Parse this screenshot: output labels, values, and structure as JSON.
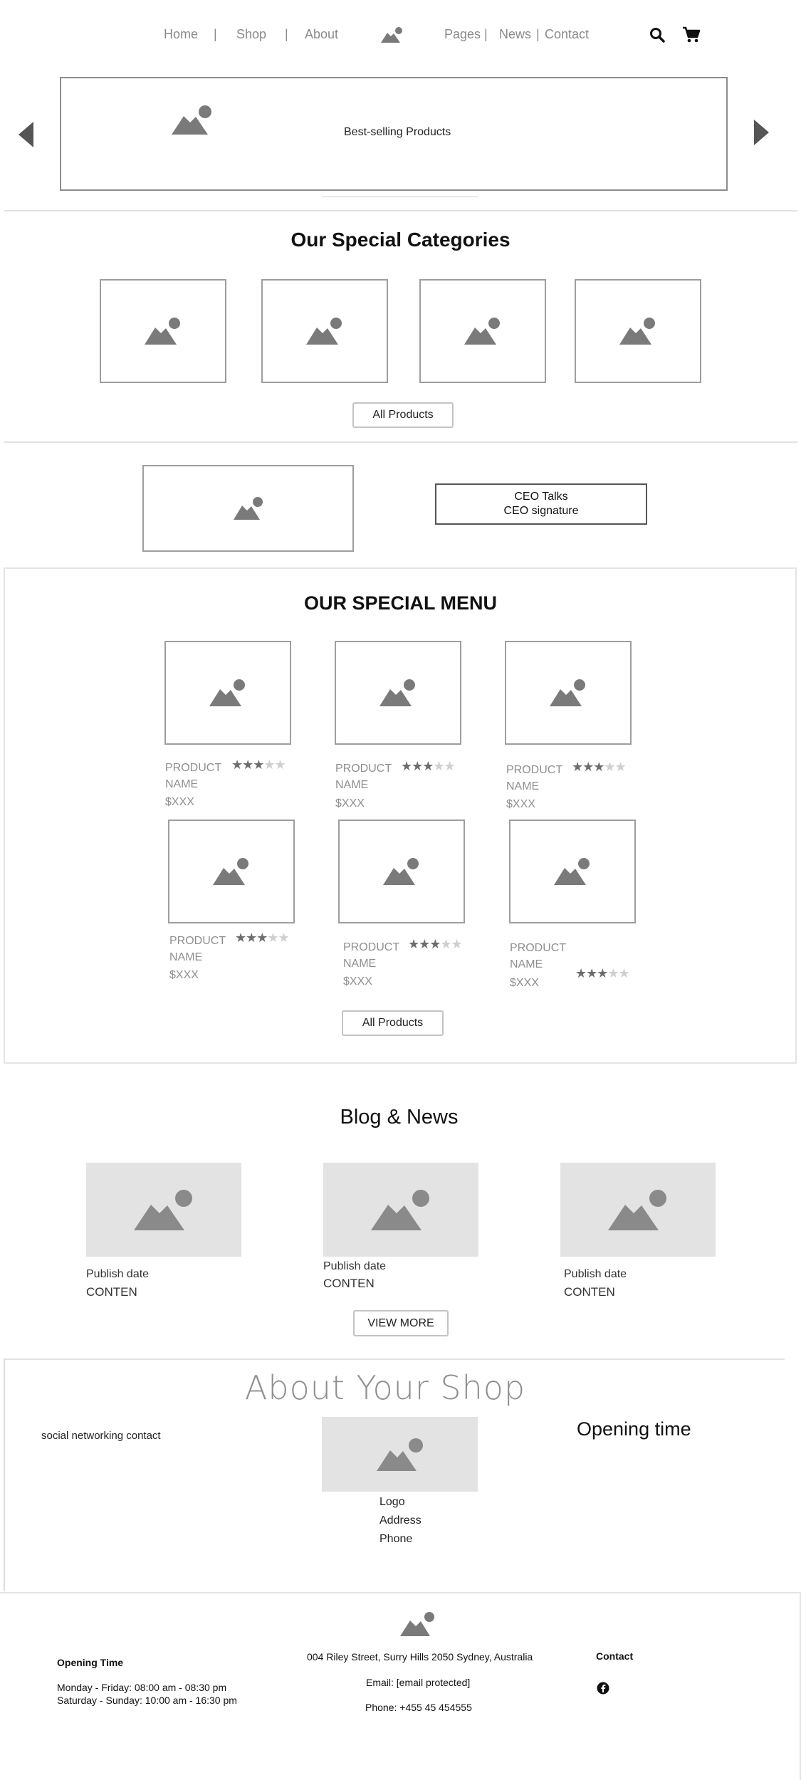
{
  "nav": {
    "links_left": [
      "Home",
      "Shop",
      "About"
    ],
    "links_right": [
      "Pages",
      "News",
      "Contact"
    ],
    "icons": [
      "logo-icon",
      "search-icon",
      "cart-icon"
    ]
  },
  "hero": {
    "label": "Best-selling Products",
    "icons": [
      "arrow-left-icon",
      "arrow-right-icon",
      "image-icon"
    ]
  },
  "categories": {
    "title": "Our Special Categories",
    "button": "All Products"
  },
  "ceo": {
    "line1": "CEO Talks",
    "line2": "CEO signature"
  },
  "menu": {
    "title": "OUR SPECIAL MENU",
    "products": [
      {
        "name": "PRODUCT NAME",
        "price": "$XXX",
        "rating": 3,
        "max": 5
      },
      {
        "name": "PRODUCT NAME",
        "price": "$XXX",
        "rating": 3,
        "max": 5
      },
      {
        "name": "PRODUCT NAME",
        "price": "$XXX",
        "rating": 3,
        "max": 5
      },
      {
        "name": "PRODUCT NAME",
        "price": "$XXX",
        "rating": 3,
        "max": 5
      },
      {
        "name": "PRODUCT NAME",
        "price": "$XXX",
        "rating": 3,
        "max": 5
      },
      {
        "name": "PRODUCT NAME",
        "price": "$XXX",
        "rating": 3,
        "max": 5
      }
    ],
    "button": "All Products"
  },
  "blog": {
    "title": "Blog & News",
    "posts": [
      {
        "date": "Publish date",
        "content": "CONTENT"
      },
      {
        "date": "Publish date",
        "content": "CONTENT"
      },
      {
        "date": "Publish date",
        "content": "CONTENT"
      }
    ],
    "button": "VIEW MORE"
  },
  "about": {
    "title": "About Your Shop",
    "social": "social networking contact",
    "opening": "Opening time",
    "logo": "Logo",
    "address": "Address",
    "phone": "Phone"
  },
  "footer": {
    "opening_title": "Opening Time",
    "hours": [
      "Monday - Friday: 08:00 am - 08:30 pm",
      "Saturday - Sunday: 10:00 am - 16:30 pm"
    ],
    "address": "004 Riley Street, Surry Hills 2050 Sydney, Australia",
    "email": "Email: [email protected]",
    "phone": "Phone: +455 45 454555",
    "contact_title": "Contact",
    "icons": [
      "facebook-icon"
    ]
  },
  "colors": {
    "placeholder_icon": "#7a7a7a",
    "placeholder_fill": "#e3e3e3",
    "border": "#9e9e9e",
    "star_on": "#6d6d6d",
    "star_off": "#cfcfcf"
  }
}
